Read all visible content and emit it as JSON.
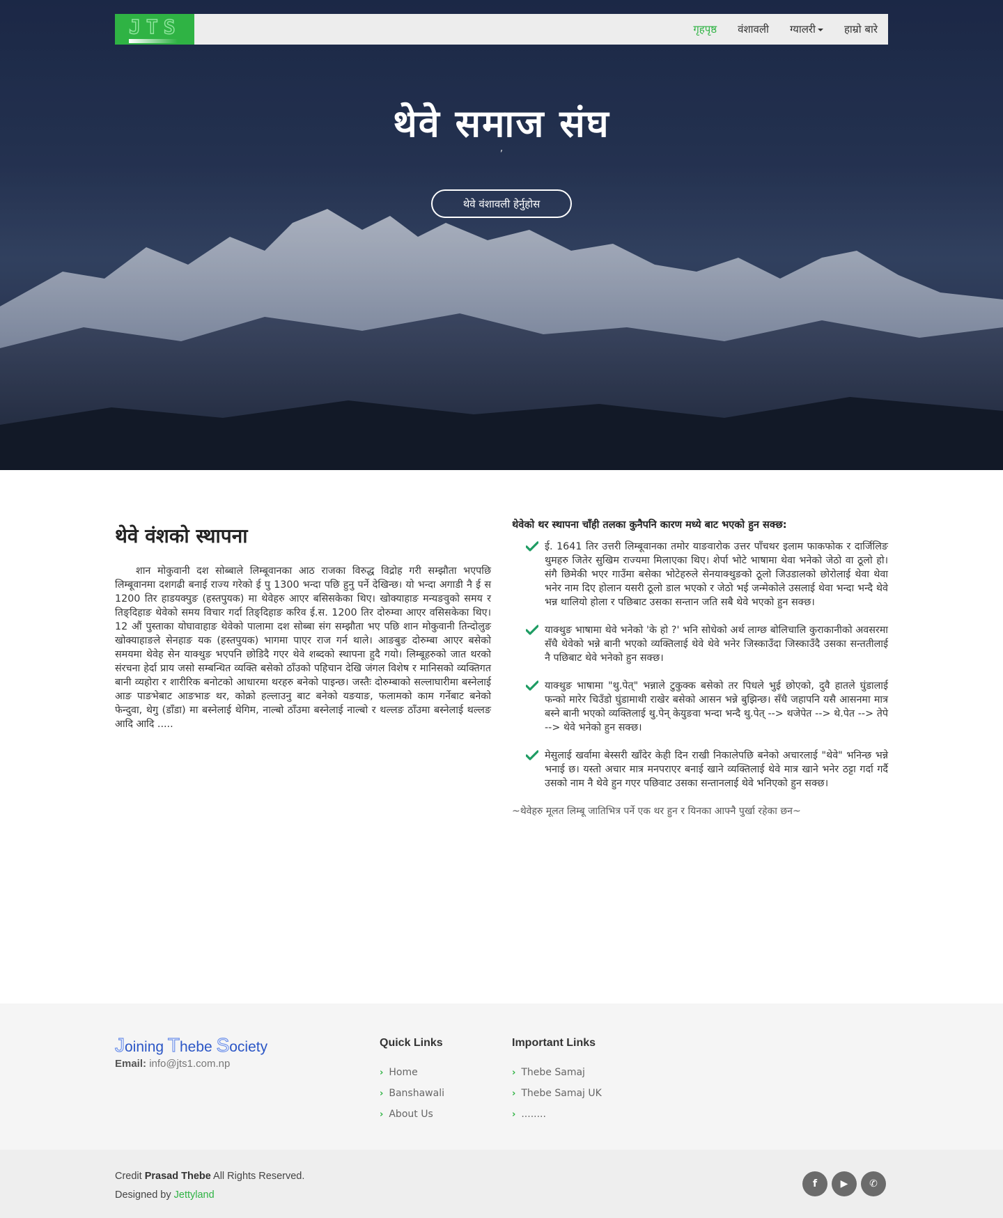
{
  "nav": {
    "brand": "JTS",
    "items": [
      {
        "label": "गृहपृष्ठ",
        "active": true
      },
      {
        "label": "वंशावली"
      },
      {
        "label": "ग्यालरी",
        "has_dropdown": true
      },
      {
        "label": "हाम्रो बारे"
      }
    ]
  },
  "hero": {
    "title": "थेवे समाज संघ",
    "subtitle": ",",
    "button": "थेवे वंशावली हेर्नुहोस"
  },
  "intro": {
    "heading": "थेवे वंशको स्थापना",
    "paragraph": "शान मोकुवानी दश सोब्बाले लिम्बूवानका आठ राजका विरुद्ध विद्रोह गरी सम्झौता भएपछि लिम्बूवानमा दशगढी बनाई राज्य गरेको ई पु 1300 भन्दा पछि हुनु पर्ने देखिन्छ। यो भन्दा अगाडी नै ई स 1200 तिर हाडयक्पुङ (हस्तपुयक) मा थेवेहरु आएर बसिसकेका थिए। खोक्याहाङ मन्यङवुको समय र तिङ्दिहाङ थेवेको समय विचार गर्दा तिङ्दिहाङ करिव ई.स. 1200 तिर दोरुम्वा आएर वसिसकेका थिए। 12 औं पुस्ताका योघावाहाङ थेवेको पालामा दश सोब्बा संग सम्झौता भए पछि शान मोकुवानी तिन्दोलुङ खोक्याहाङले सेनहाङ यक (हस्तपुयक) भागमा पाएर राज गर्न थाले। आङबुङ दोरुम्बा आएर बसेको समयमा थेवेह सेन याक्थुङ भएपनि छोडिदै गएर थेवे शब्दको स्थापना हुदै गयो। लिम्बूहरुको जात थरको संरचना हेर्दा प्राय जसो सम्बन्धित व्यक्ति बसेको ठाँउको पहिचान देखि जंगल विशेष र मानिसको व्यक्तिगत बानी व्यहोरा र शारीरिक बनोटको आधारमा थरहरु बनेको पाइन्छ। जस्तैः दोरुम्बाको सल्लाघारीमा बस्नेलाई आङ पाङभेबाट आङभाङ थर, कोक्रो हल्लाउनु बाट बनेको यङयाङ, फलामको काम गर्नेबाट बनेको फेन्दुवा, थेगु (डाँडा) मा बस्नेलाई थेगिम, नाल्बो ठाँउमा बस्नेलाई नाल्बो र थल्लङ ठाँउमा बस्नेलाई थल्लङ आदि आदि ....."
  },
  "reasons": {
    "heading": "थेवेको थर स्थापना चाँही तलका कुनैपनि कारण मध्ये बाट भएको हुन सक्छ:",
    "items": [
      "ई. 1641 तिर उत्तरी लिम्बूवानका तमोर याङवारोक उत्तर पाँचथर इलाम फाकफोक र दार्जिलिङ थुमहरु जितेर सुखिम राज्यमा मिलाएका थिए। शेर्पा भोटे भाषामा थेवा भनेको जेठो वा ठूलो हो। संगै छिमेकी भएर गाउँमा बसेका भोटेहरुले सेनयाक्थुङको ठूलो जिउडालको छोरोलाई थेवा थेवा भनेर नाम दिए होलान यसरी ठूलो डाल भएको र जेठो भई जन्मेकोले उसलाई थेवा भन्दा भन्दै थेवे भन्न थालियो होला र पछिबाट उसका सन्तान जति सबै थेवे भएको हुन सक्छ।",
      "याक्थुङ भाषामा थेवे भनेको 'के हो ?' भनि सोधेको अर्थ लाग्छ बोलिचालि कुराकानीको अवसरमा सँधै थेवेको भन्ने बानी भएको व्यक्तिलाई थेवे थेवे भनेर जिस्काउँदा जिस्काउँदै उसका सन्ततीलाई नै पछिबाट थेवे भनेको हुन सक्छ।",
      "याक्थुङ भाषामा \"थु.पेत्\" भन्नाले टुकुक्क बसेको तर पिधले भुई छोएको, दुवै हातले घुंडालाई फन्को मारेर चिउँडो घुंडामाथी राखेर बसेको आसन भन्ने बुझिन्छ। सँधै जहापनि यसै आसनमा मात्र बस्ने बानी भएको व्यक्तिलाई थु.पेन् केयुङवा भन्दा भन्दै थु.पेत् --> थजेपेत --> थे.पेत --> तेपे --> थेवे भनेको हुन सक्छ।",
      "मेसुलाई खर्वामा बेस्सरी खाँदेर केही दिन राखी निकालेपछि बनेको अचारलाई \"थेवे\" भनिन्छ भन्ने भनाई छ। यस्तो अचार मात्र मनपराएर बनाई खाने व्यक्तिलाई थेवे मात्र खाने भनेर ठट्टा गर्दा गर्दै उसको नाम नै थेवे हुन गएर पछिवाट उसका सन्तानलाई थेवे भनिएको हुन सक्छ।"
    ],
    "quote": "~थेवेहरु मूलत लिम्बू जातिभित्र पर्ने एक थर हुन र यिनका आफ्नै पुर्खा रहेका छन~"
  },
  "footer": {
    "brand": {
      "J": "J",
      "oining": "oining ",
      "T": "T",
      "hebe": "hebe ",
      "S": "S",
      "ociety": "ociety"
    },
    "email_label": "Email:",
    "email": "info@jts1.com.np",
    "quick_links": {
      "title": "Quick Links",
      "items": [
        "Home",
        "Banshawali",
        "About Us"
      ]
    },
    "important_links": {
      "title": "Important Links",
      "items": [
        "Thebe Samaj",
        "Thebe Samaj UK",
        "........"
      ]
    }
  },
  "bottom": {
    "credit_prefix": "Credit ",
    "credit_name": "Prasad Thebe",
    "credit_suffix": " All Rights Reserved.",
    "designed_prefix": "Designed by ",
    "designer": "Jettyland",
    "socials": [
      {
        "icon": "facebook-icon",
        "glyph": "f"
      },
      {
        "icon": "youtube-icon",
        "glyph": "▶"
      },
      {
        "icon": "whatsapp-icon",
        "glyph": "✆"
      }
    ]
  },
  "colors": {
    "accent": "#2fb344",
    "hero_dark": "#1f2c4c",
    "footer_bg": "#f5f5f5",
    "bottom_bg": "#eeeeee",
    "brand_blue": "#2b56c6"
  }
}
